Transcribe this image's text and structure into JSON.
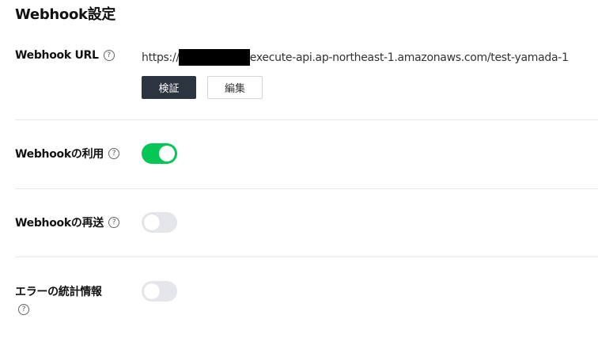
{
  "section_title": "Webhook設定",
  "webhook_url": {
    "label": "Webhook URL",
    "prefix": "https://",
    "suffix": "execute-api.ap-northeast-1.amazonaws.com/test-yamada-1",
    "verify_button": "検証",
    "edit_button": "編集"
  },
  "use_webhook": {
    "label": "Webhookの利用",
    "enabled": true
  },
  "redelivery": {
    "label": "Webhookの再送",
    "enabled": false
  },
  "error_stats": {
    "label": "エラーの統計情報",
    "enabled": false
  },
  "help_icon_glyph": "?",
  "colors": {
    "toggle_on": "#06c755",
    "toggle_off": "#e4e6ea",
    "primary_button": "#2c3440"
  }
}
